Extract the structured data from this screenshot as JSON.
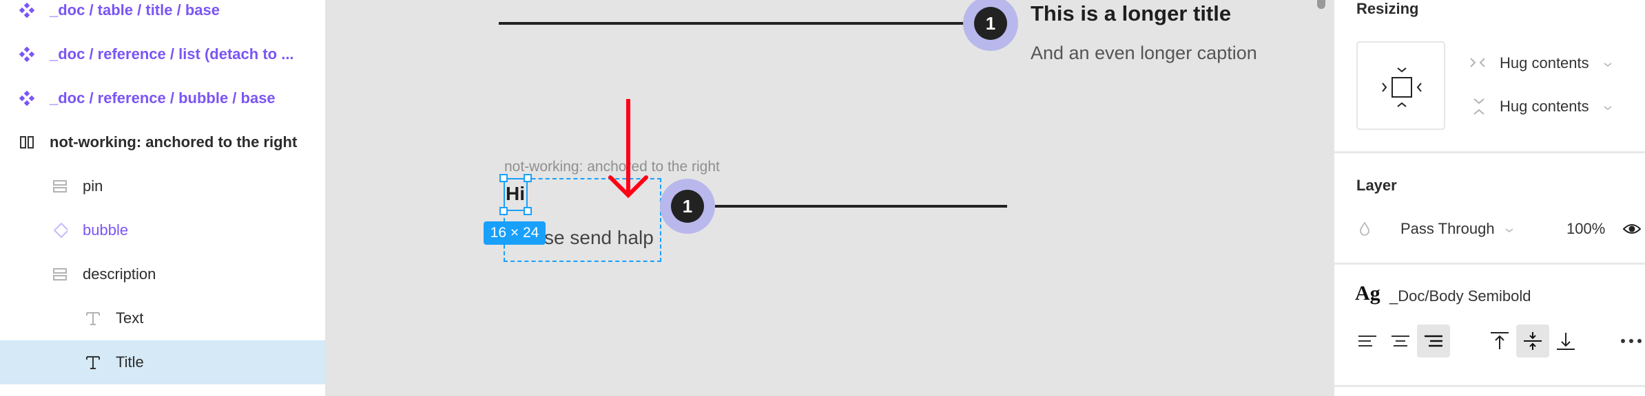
{
  "layers_panel": {
    "rows": [
      {
        "label": "_doc / table / title / base",
        "icon": "component-icon",
        "kind": "comp",
        "indent": 0
      },
      {
        "label": "_doc / reference / list  (detach to ...",
        "icon": "component-icon",
        "kind": "comp",
        "indent": 0
      },
      {
        "label": "_doc / reference / bubble / base",
        "icon": "component-icon",
        "kind": "comp",
        "indent": 0
      },
      {
        "label": "not-working: anchored to the right",
        "icon": "horizontal-autolayout-icon",
        "kind": "frame",
        "indent": 0
      },
      {
        "label": "pin",
        "icon": "vertical-autolayout-icon",
        "kind": "plain",
        "indent": 1
      },
      {
        "label": "bubble",
        "icon": "instance-icon",
        "kind": "inst",
        "indent": 1
      },
      {
        "label": "description",
        "icon": "vertical-autolayout-icon",
        "kind": "plain",
        "indent": 1
      },
      {
        "label": "Text",
        "icon": "text-icon",
        "kind": "plain",
        "indent": 2
      },
      {
        "label": "Title",
        "icon": "text-icon",
        "kind": "plain",
        "indent": 2,
        "selected": true
      }
    ]
  },
  "canvas": {
    "top_item": {
      "bubble_number": "1",
      "title": "This is a longer title",
      "caption": "And an even longer caption"
    },
    "frame": {
      "label": "not-working: anchored to the right",
      "selected_text": "Hi",
      "size_badge": "16 × 24",
      "body_text": "Please send halp",
      "bubble_number": "1"
    },
    "colors": {
      "selection": "#18a0fb",
      "bubble_ring": "#b8b8ec",
      "arrow": "#ff0016",
      "canvas_bg": "#e4e4e4"
    }
  },
  "properties_panel": {
    "resizing": {
      "title": "Resizing",
      "horizontal": "Hug contents",
      "vertical": "Hug contents"
    },
    "layer": {
      "title": "Layer",
      "blend_mode": "Pass Through",
      "opacity": "100%"
    },
    "text": {
      "style_preview": "Ag",
      "style_name": "_Doc/Body Semibold",
      "align_horizontal": [
        "left",
        "center",
        "right"
      ],
      "align_horizontal_active": "right",
      "align_vertical": [
        "top",
        "middle",
        "bottom"
      ],
      "align_vertical_active": "middle"
    }
  }
}
